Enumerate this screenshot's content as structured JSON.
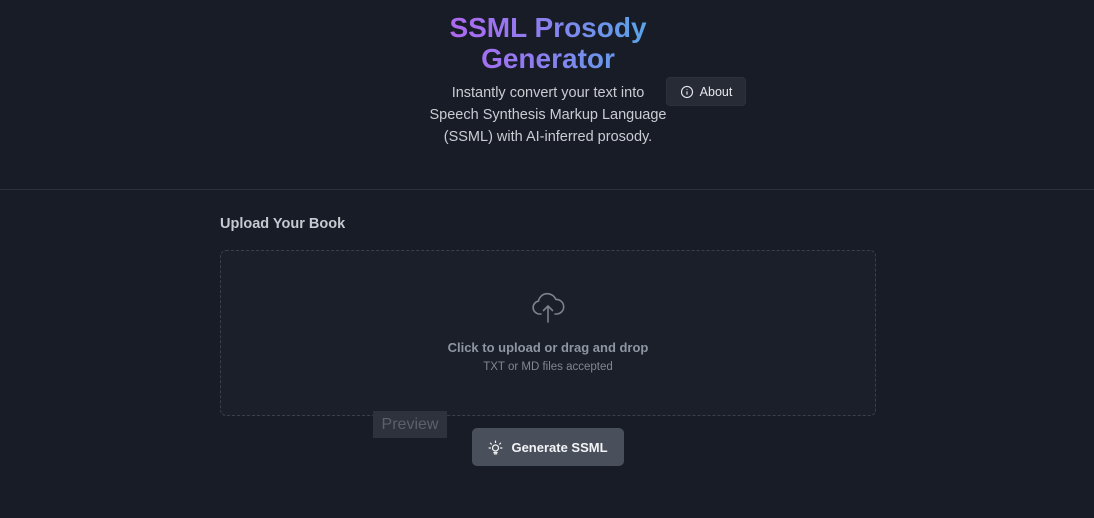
{
  "header": {
    "title": "SSML Prosody Generator",
    "subtitle": "Instantly convert your text into Speech Synthesis Markup Language (SSML) with AI-inferred prosody.",
    "about_label": "About",
    "about_icon": "info-icon"
  },
  "upload": {
    "section_title": "Upload Your Book",
    "icon": "cloud-upload-icon",
    "main_text": "Click to upload or drag and drop",
    "sub_text": "TXT or MD files accepted"
  },
  "actions": {
    "preview_label": "Preview",
    "generate_label": "Generate SSML",
    "generate_icon": "lightbulb-icon"
  },
  "colors": {
    "background": "#181c26",
    "title_gradient_start": "#c35cf0",
    "title_gradient_end": "#3fb6e6",
    "button": "#4a505b"
  }
}
